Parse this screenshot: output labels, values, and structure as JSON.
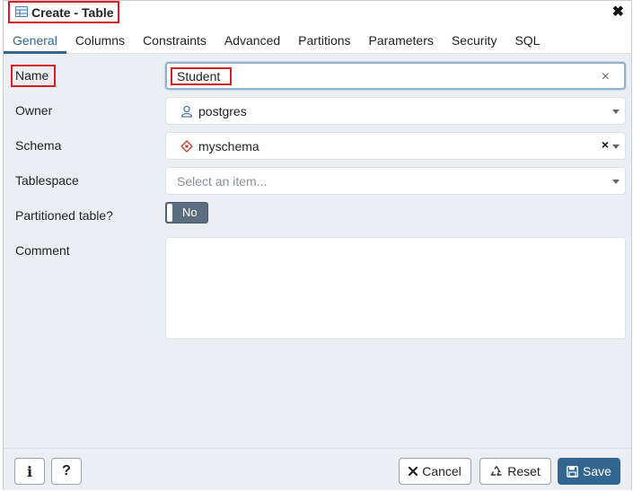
{
  "dialog": {
    "title": "Create - Table",
    "close_symbol": "✖",
    "title_icon": "table-icon"
  },
  "tabs": [
    {
      "label": "General",
      "active": true
    },
    {
      "label": "Columns"
    },
    {
      "label": "Constraints"
    },
    {
      "label": "Advanced"
    },
    {
      "label": "Partitions"
    },
    {
      "label": "Parameters"
    },
    {
      "label": "Security"
    },
    {
      "label": "SQL"
    }
  ],
  "form": {
    "name": {
      "label": "Name",
      "value": "Student",
      "clear_symbol": "×"
    },
    "owner": {
      "label": "Owner",
      "value": "postgres",
      "icon": "user-icon"
    },
    "schema": {
      "label": "Schema",
      "value": "myschema",
      "icon": "schema-icon",
      "clear_symbol": "×"
    },
    "tablespace": {
      "label": "Tablespace",
      "placeholder": "Select an item..."
    },
    "partitioned": {
      "label": "Partitioned table?",
      "value": "No"
    },
    "comment": {
      "label": "Comment",
      "value": ""
    }
  },
  "footer": {
    "info_icon": "info-icon",
    "help_icon": "help-icon",
    "info_symbol": "i",
    "help_symbol": "?",
    "cancel_label": "Cancel",
    "reset_label": "Reset",
    "save_label": "Save"
  },
  "colors": {
    "accent": "#326690",
    "highlight": "#d91c24",
    "background": "#ebeef3"
  }
}
